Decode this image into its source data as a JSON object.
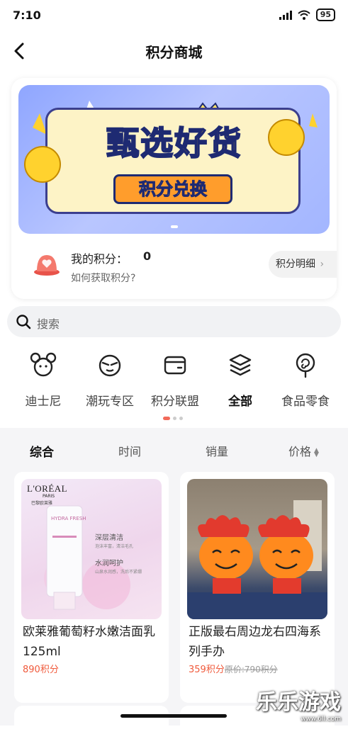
{
  "status": {
    "time": "7:10",
    "battery": "95"
  },
  "nav": {
    "title": "积分商城"
  },
  "banner": {
    "title_part1": "甄选",
    "title_part2": "好货",
    "subtitle": "积分兑换"
  },
  "points": {
    "label": "我的积分：",
    "value": "0",
    "howto": "如何获取积分?",
    "detail_label": "积分明细"
  },
  "search": {
    "placeholder": "搜索"
  },
  "categories": [
    {
      "label": "迪士尼",
      "icon": "mouse-ears-icon"
    },
    {
      "label": "潮玩专区",
      "icon": "toy-face-icon"
    },
    {
      "label": "积分联盟",
      "icon": "wallet-icon"
    },
    {
      "label": "全部",
      "icon": "layers-icon"
    },
    {
      "label": "食品零食",
      "icon": "lollipop-icon"
    }
  ],
  "sort": {
    "general": "综合",
    "time": "时间",
    "sales": "销量",
    "price": "价格"
  },
  "products": [
    {
      "name": "欧莱雅葡萄籽水嫩洁面乳 125ml",
      "price": "890积分",
      "image_text": {
        "brand": "L'ORÉAL",
        "brand_sub": "PARIS",
        "cn_brand": "巴黎欧莱雅",
        "line": "HYDRA FRESH",
        "tag1": "深层清洁",
        "tag1_sub": "泡沫丰富，清洁毛孔",
        "tag2": "水润呵护",
        "tag2_sub": "山泉水润感，洗后不紧绷"
      }
    },
    {
      "name": "正版最右周边龙右四海系列手办",
      "price": "359积分",
      "orig_price": "原价:790积分"
    }
  ],
  "watermark": {
    "main": "乐乐游戏",
    "sub": "www.6ll.com"
  },
  "colors": {
    "accent": "#f05a3c",
    "banner_blue": "#8fa6ff"
  }
}
